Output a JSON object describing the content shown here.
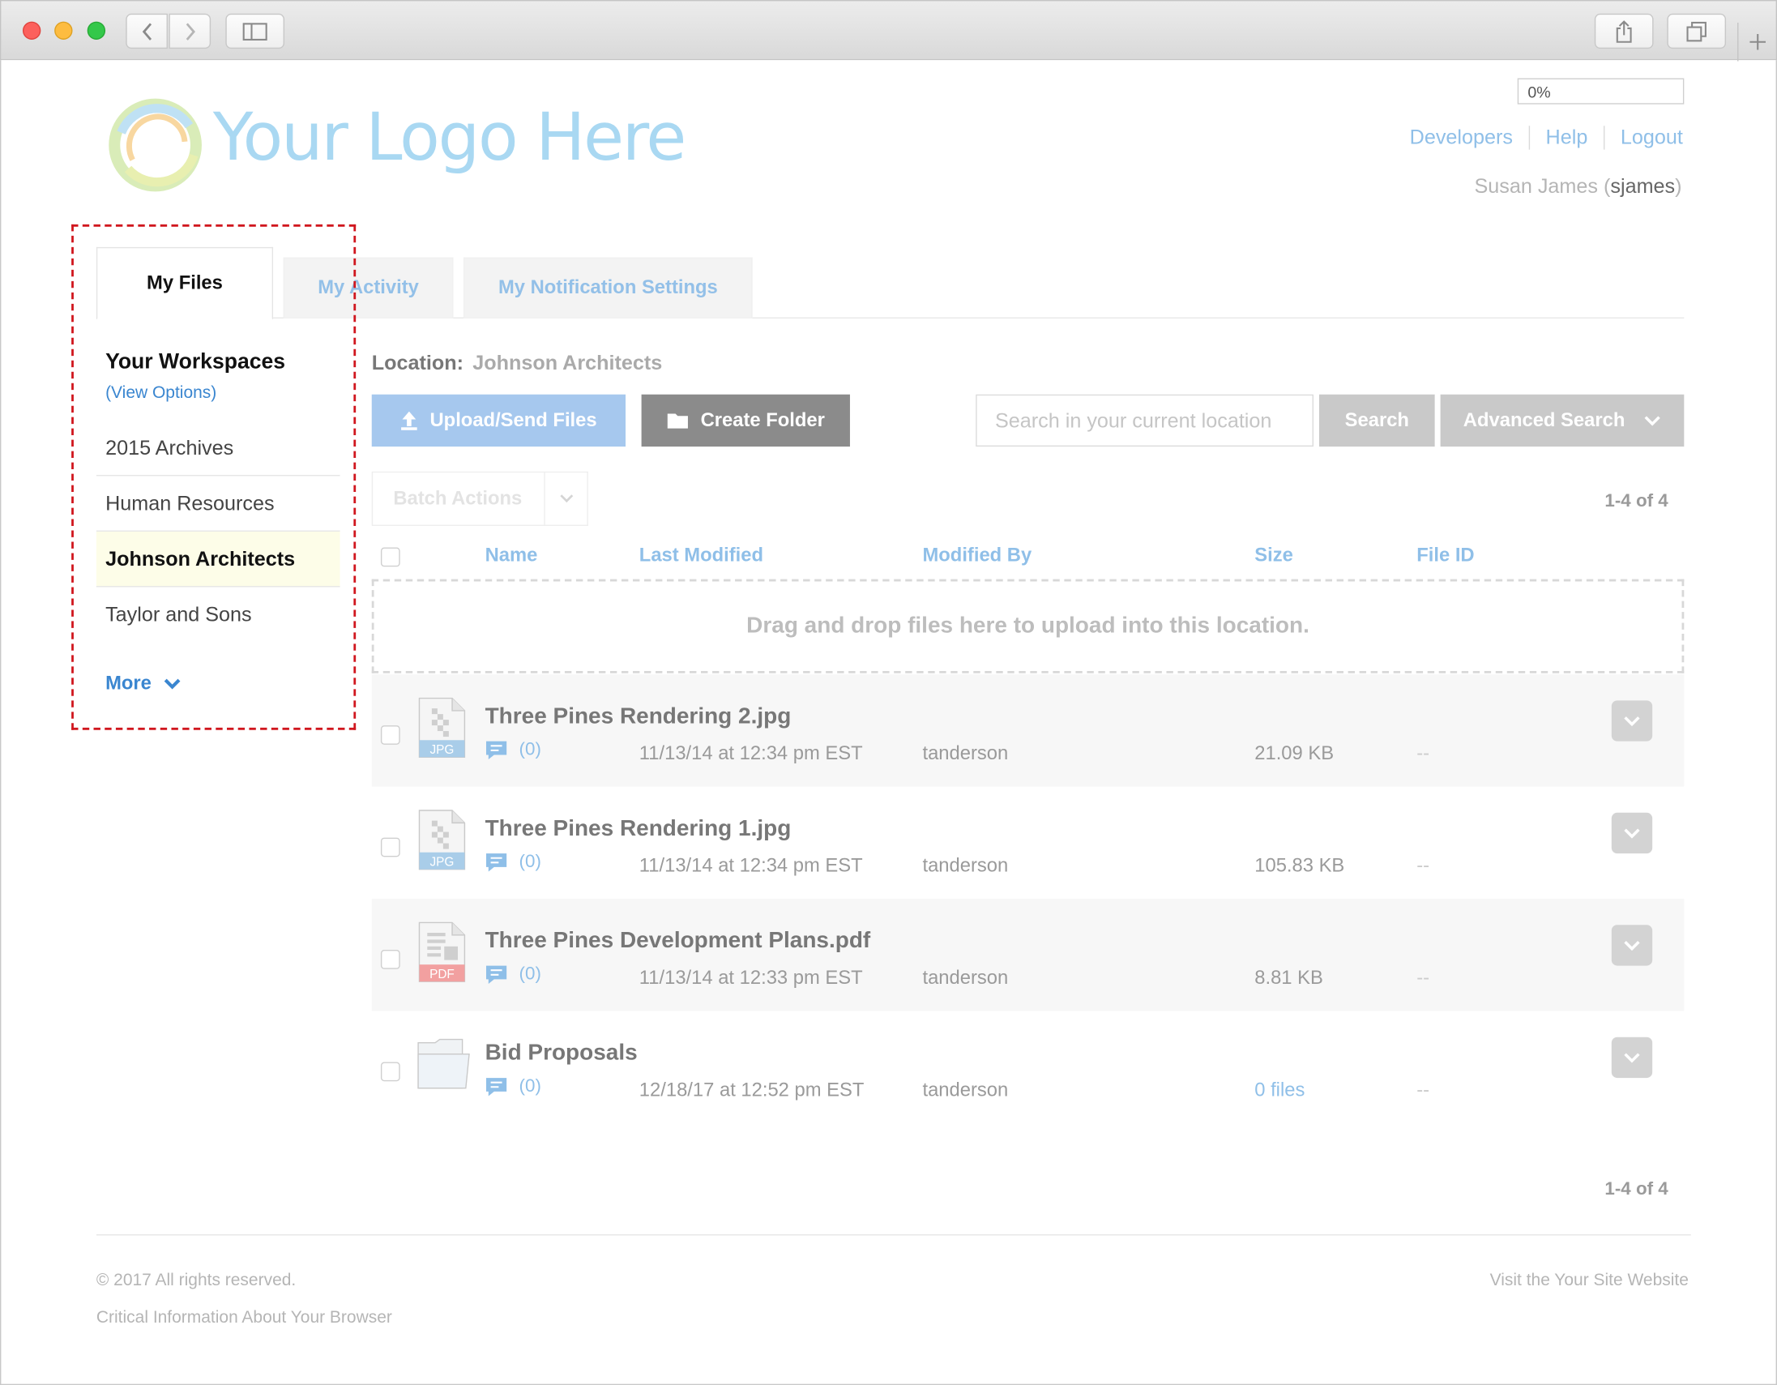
{
  "browser": {
    "back_icon": "chevron-left-icon",
    "forward_icon": "chevron-right-icon",
    "sidebar_icon": "sidebar-icon",
    "share_icon": "share-icon",
    "tabs_icon": "tabs-icon",
    "new_tab_icon": "plus-icon"
  },
  "header": {
    "logo_text": "Your Logo Here",
    "progress": "0%",
    "links": [
      "Developers",
      "Help",
      "Logout"
    ],
    "user_name": "Susan James",
    "user_login": "sjames",
    "user_open": " (",
    "user_close": ")"
  },
  "tabs": [
    {
      "label": "My Files",
      "active": true
    },
    {
      "label": "My Activity",
      "active": false
    },
    {
      "label": "My Notification Settings",
      "active": false
    }
  ],
  "sidebar": {
    "title": "Your Workspaces",
    "view_options": "(View Options)",
    "items": [
      {
        "label": "2015 Archives",
        "selected": false
      },
      {
        "label": "Human Resources",
        "selected": false
      },
      {
        "label": "Johnson Architects",
        "selected": true
      },
      {
        "label": "Taylor and Sons",
        "selected": false
      }
    ],
    "more": "More"
  },
  "main": {
    "location_label": "Location:",
    "location_value": "Johnson Architects",
    "upload_button": "Upload/Send Files",
    "create_folder_button": "Create Folder",
    "search_placeholder": "Search in your current location",
    "search_button": "Search",
    "advanced_search_button": "Advanced Search",
    "batch_actions": "Batch Actions",
    "count_top": "1-4 of 4",
    "count_bottom": "1-4 of 4",
    "columns": [
      "Name",
      "Last Modified",
      "Modified By",
      "Size",
      "File ID"
    ],
    "drop_zone": "Drag and drop files here to upload into this location.",
    "files": [
      {
        "name": "Three Pines Rendering 2.jpg",
        "type": "JPG",
        "comments": "(0)",
        "modified": "11/13/14 at 12:34 pm EST",
        "by": "tanderson",
        "size": "21.09 KB",
        "file_id": "--"
      },
      {
        "name": "Three Pines Rendering 1.jpg",
        "type": "JPG",
        "comments": "(0)",
        "modified": "11/13/14 at 12:34 pm EST",
        "by": "tanderson",
        "size": "105.83 KB",
        "file_id": "--"
      },
      {
        "name": "Three Pines Development Plans.pdf",
        "type": "PDF",
        "comments": "(0)",
        "modified": "11/13/14 at 12:33 pm EST",
        "by": "tanderson",
        "size": "8.81 KB",
        "file_id": "--"
      },
      {
        "name": "Bid Proposals",
        "type": "folder",
        "comments": "(0)",
        "modified": "12/18/17 at 12:52 pm EST",
        "by": "tanderson",
        "size": "0 files",
        "file_id": "--"
      }
    ]
  },
  "footer": {
    "copyright": "© 2017 All rights reserved.",
    "browser_info": "Critical Information About Your Browser",
    "site_link": "Visit the Your Site Website"
  },
  "colors": {
    "accent_link": "#3a86d0",
    "light_link": "#8fbfe8",
    "upload_button": "#a6c8ee",
    "create_folder_button": "#8b8b8b",
    "highlight_box": "#d0161e",
    "selected_workspace_bg": "#fdfde8"
  }
}
